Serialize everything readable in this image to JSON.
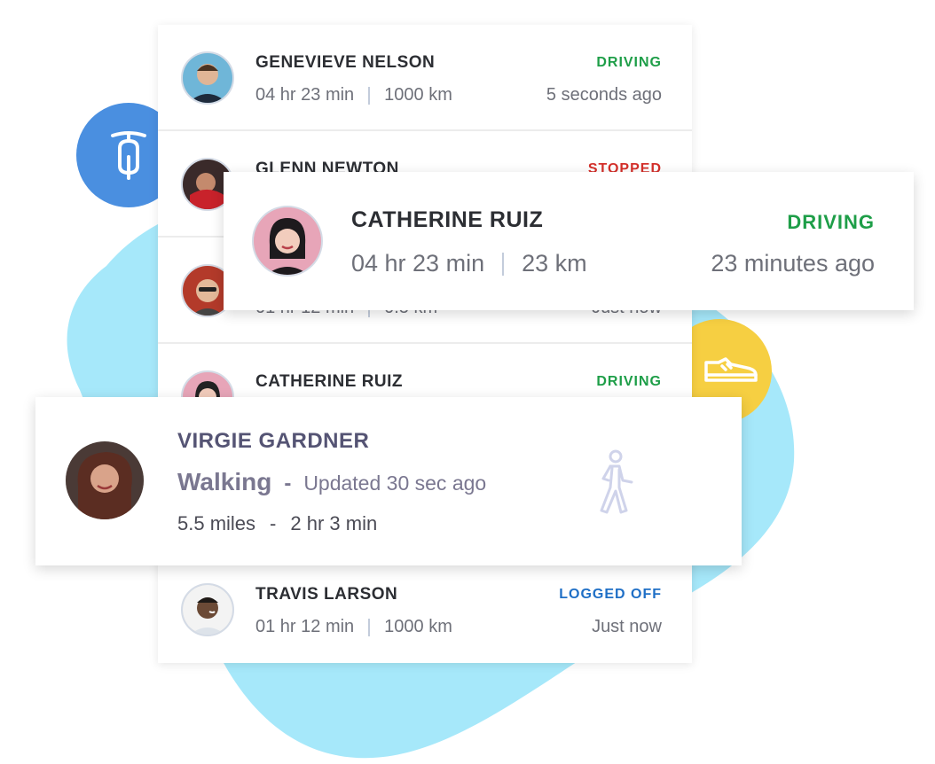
{
  "list_rows": [
    {
      "name": "GENEVIEVE NELSON",
      "status": "DRIVING",
      "duration": "04 hr 23 min",
      "distance": "1000 km",
      "ago": "5 seconds ago"
    },
    {
      "name": "GLENN NEWTON",
      "status": "STOPPED",
      "duration": "",
      "distance": "",
      "ago": ""
    },
    {
      "name": "",
      "status": "",
      "duration": "01 hr 12 min",
      "distance": "0.5 km",
      "ago": "Just now"
    },
    {
      "name": "CATHERINE RUIZ",
      "status": "DRIVING",
      "duration": "",
      "distance": "",
      "ago": ""
    },
    {
      "name": "",
      "status": "",
      "duration": "",
      "distance": "",
      "ago": ""
    },
    {
      "name": "TRAVIS LARSON",
      "status": "LOGGED OFF",
      "duration": "01 hr 12 min",
      "distance": "1000 km",
      "ago": "Just now"
    }
  ],
  "highlight_card": {
    "name": "CATHERINE RUIZ",
    "status": "DRIVING",
    "duration": "04 hr 23 min",
    "distance": "23 km",
    "ago": "23 minutes ago"
  },
  "walking_card": {
    "name": "VIRGIE GARDNER",
    "activity": "Walking",
    "dash": "-",
    "updated": "Updated 30 sec ago",
    "distance": "5.5 miles",
    "dash2": "-",
    "duration": "2 hr 3 min"
  },
  "icons": {
    "scooter": "scooter-icon",
    "shoe": "shoe-icon",
    "walk": "walking-person-icon"
  },
  "colors": {
    "driving": "#1e9e48",
    "stopped": "#d4302b",
    "logged_off": "#1f6fc6",
    "blob": "#a6e8fa",
    "scooter_circle": "#4a8fe0",
    "shoe_circle": "#f6cf42"
  }
}
